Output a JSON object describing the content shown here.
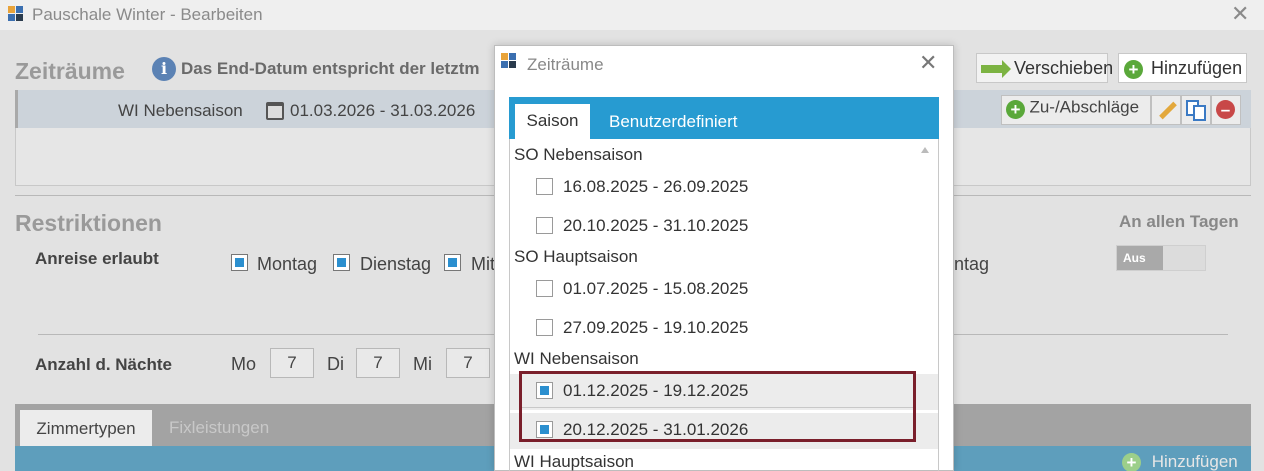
{
  "window": {
    "title": "Pauschale Winter - Bearbeiten",
    "close_glyph": "✕"
  },
  "zeitraeume": {
    "heading": "Zeiträume",
    "info_text": "Das End-Datum entspricht der letztm",
    "buttons": {
      "verschieben": "Verschieben",
      "hinzufuegen": "Hinzufügen"
    },
    "period": {
      "name": "WI Nebensaison",
      "dates": "01.03.2026 - 31.03.2026",
      "zu_abschlaege": "Zu-/Abschläge"
    }
  },
  "restriktionen": {
    "heading": "Restriktionen",
    "an_allen_tagen": "An allen Tagen",
    "toggle_label": "Aus",
    "anreise_label": "Anreise erlaubt",
    "days": [
      "Montag",
      "Dienstag",
      "Mit",
      "ntag"
    ],
    "naechte_label": "Anzahl d. Nächte",
    "nights": [
      {
        "day": "Mo",
        "value": "7"
      },
      {
        "day": "Di",
        "value": "7"
      },
      {
        "day": "Mi",
        "value": "7"
      }
    ]
  },
  "bottom": {
    "tabs": [
      "Zimmertypen",
      "Fixleistungen"
    ],
    "add_label": "Hinzufügen"
  },
  "dialog": {
    "title": "Zeiträume",
    "close_glyph": "✕",
    "tabs": [
      "Saison",
      "Benutzerdefiniert"
    ],
    "groups": [
      {
        "name": "SO Nebensaison",
        "items": [
          {
            "label": "16.08.2025 - 26.09.2025",
            "checked": false
          },
          {
            "label": "20.10.2025 - 31.10.2025",
            "checked": false
          }
        ]
      },
      {
        "name": "SO Hauptsaison",
        "items": [
          {
            "label": "01.07.2025 - 15.08.2025",
            "checked": false
          },
          {
            "label": "27.09.2025 - 19.10.2025",
            "checked": false
          }
        ]
      },
      {
        "name": "WI Nebensaison",
        "items": [
          {
            "label": "01.12.2025 - 19.12.2025",
            "checked": true
          },
          {
            "label": "20.12.2025 - 31.01.2026",
            "checked": true
          }
        ]
      },
      {
        "name": "WI Hauptsaison",
        "items": []
      }
    ]
  },
  "colors": {
    "accent_blue": "#279bd1",
    "checkbox_blue": "#2b8fcf",
    "highlight_border": "#7a1f2b",
    "add_green": "#5aa83a",
    "delete_red": "#c84848"
  }
}
